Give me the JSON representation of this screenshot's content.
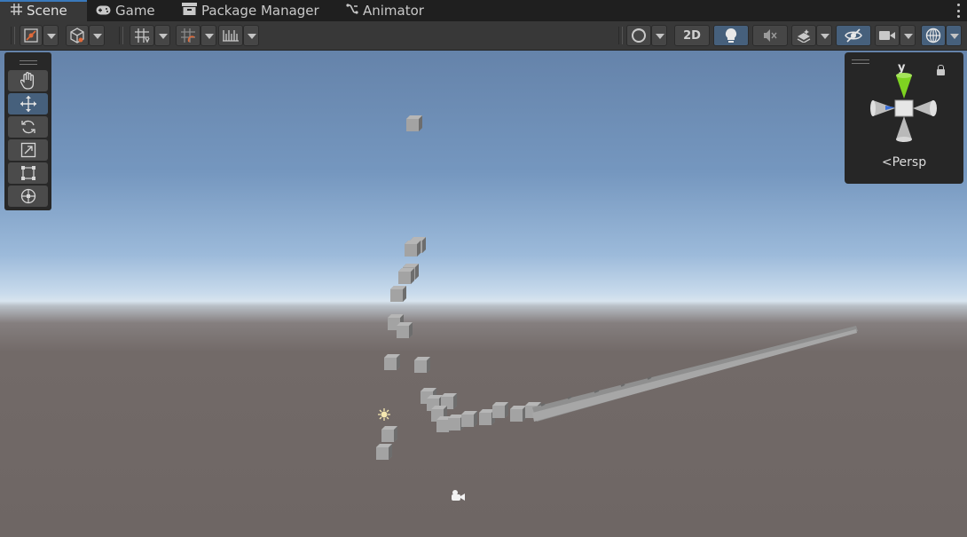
{
  "tabs": [
    {
      "label": "Scene",
      "icon": "grid-icon",
      "active": true
    },
    {
      "label": "Game",
      "icon": "gamepad-icon",
      "active": false
    },
    {
      "label": "Package Manager",
      "icon": "package-icon",
      "active": false
    },
    {
      "label": "Animator",
      "icon": "animator-icon",
      "active": false
    }
  ],
  "toolbar": {
    "left": [
      "draw-mode-icon",
      "shading-mode-icon",
      "grid-snapping-icon",
      "increment-snap-icon",
      "ruler-icon"
    ],
    "right": {
      "two_d_label": "2D",
      "items": [
        "render-paths-icon",
        "lighting-icon",
        "audio-icon",
        "effects-icon",
        "visibility-icon",
        "camera-icon",
        "gizmos-icon"
      ]
    }
  },
  "tools": [
    "hand-tool",
    "move-tool",
    "rotate-tool",
    "scale-tool",
    "rect-tool",
    "transform-tool"
  ],
  "active_tool": "move-tool",
  "gizmo": {
    "axis_label": "y",
    "projection_label": "Persp"
  },
  "colors": {
    "accent": "#3a79bb",
    "active_button": "#46607c",
    "y_axis": "#7ed321",
    "x_axis": "#cc3333",
    "z_axis": "#3a6fd8",
    "ground": "#6e6664",
    "sky": "#6583aa"
  }
}
